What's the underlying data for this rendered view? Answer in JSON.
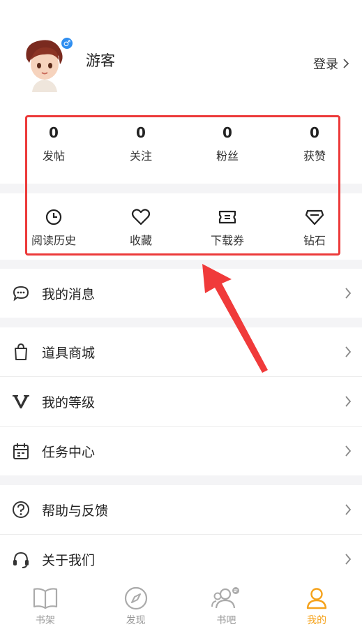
{
  "profile": {
    "username": "游客",
    "login_label": "登录",
    "gender_icon": "male-icon"
  },
  "stats": [
    {
      "value": "0",
      "label": "发帖"
    },
    {
      "value": "0",
      "label": "关注"
    },
    {
      "value": "0",
      "label": "粉丝"
    },
    {
      "value": "0",
      "label": "获赞"
    }
  ],
  "quick": [
    {
      "label": "阅读历史",
      "icon": "clock-icon"
    },
    {
      "label": "收藏",
      "icon": "heart-icon"
    },
    {
      "label": "下载券",
      "icon": "ticket-icon"
    },
    {
      "label": "钻石",
      "icon": "diamond-icon"
    }
  ],
  "menu": [
    {
      "label": "我的消息",
      "icon": "message-icon"
    },
    {
      "label": "道具商城",
      "icon": "shopping-bag-icon"
    },
    {
      "label": "我的等级",
      "icon": "level-v-icon"
    },
    {
      "label": "任务中心",
      "icon": "calendar-icon"
    },
    {
      "label": "帮助与反馈",
      "icon": "question-icon"
    },
    {
      "label": "关于我们",
      "icon": "headset-icon"
    }
  ],
  "tabs": [
    {
      "label": "书架",
      "icon": "book-icon",
      "active": false
    },
    {
      "label": "发现",
      "icon": "compass-icon",
      "active": false
    },
    {
      "label": "书吧",
      "icon": "group-icon",
      "active": false
    },
    {
      "label": "我的",
      "icon": "person-icon",
      "active": true
    }
  ],
  "colors": {
    "accent": "#f5a21b",
    "highlight": "#ec3a3a",
    "gender": "#2f8ef0"
  }
}
